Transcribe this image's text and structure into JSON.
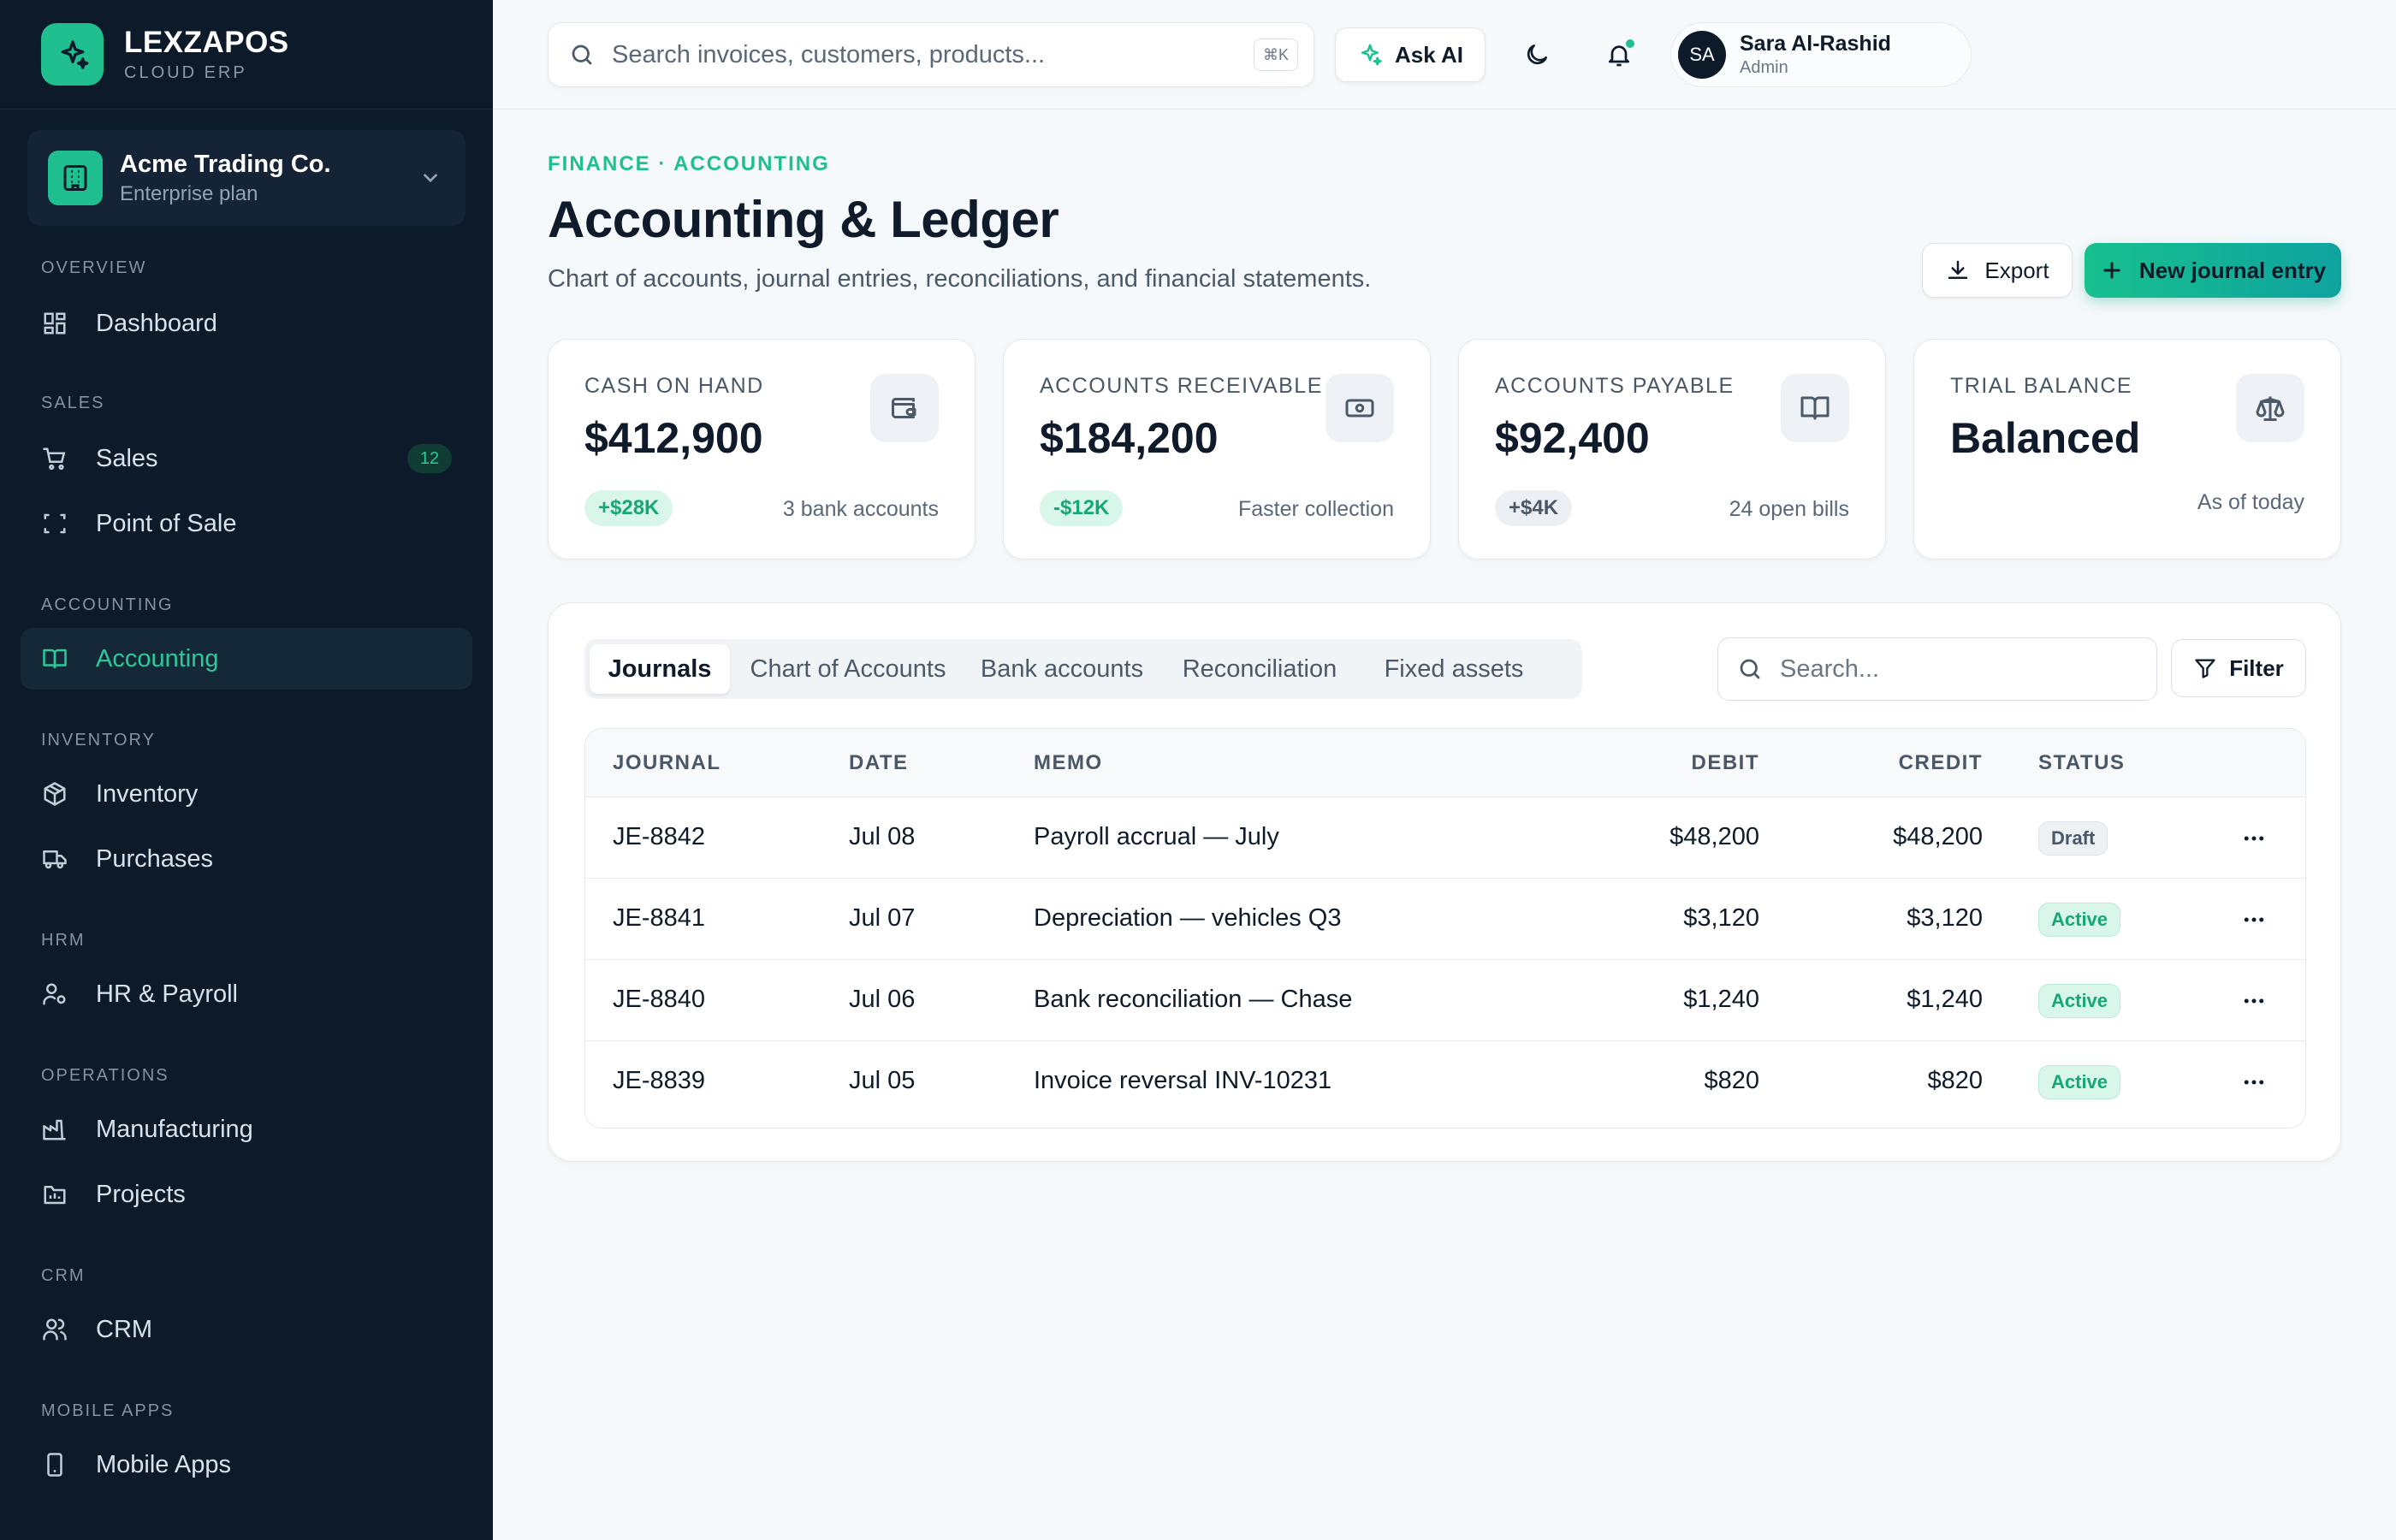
{
  "brand": {
    "name": "LEXZAPOS",
    "sub": "CLOUD ERP",
    "logo_icon": "sparkle-icon"
  },
  "org": {
    "name": "Acme Trading Co.",
    "plan": "Enterprise plan"
  },
  "sidebar": {
    "sections": [
      "OVERVIEW",
      "SALES",
      "ACCOUNTING",
      "INVENTORY",
      "HRM",
      "OPERATIONS",
      "CRM",
      "MOBILE APPS"
    ],
    "items": [
      {
        "label": "Dashboard",
        "icon": "grid-icon"
      },
      {
        "label": "Sales",
        "icon": "cart-icon",
        "badge": "12"
      },
      {
        "label": "Point of Sale",
        "icon": "scan-icon"
      },
      {
        "label": "Accounting",
        "icon": "book-icon",
        "active": true
      },
      {
        "label": "Inventory",
        "icon": "box-icon"
      },
      {
        "label": "Purchases",
        "icon": "truck-icon"
      },
      {
        "label": "HR & Payroll",
        "icon": "user-cog-icon"
      },
      {
        "label": "Manufacturing",
        "icon": "factory-icon"
      },
      {
        "label": "Projects",
        "icon": "folder-icon"
      },
      {
        "label": "CRM",
        "icon": "users-icon"
      },
      {
        "label": "Mobile Apps",
        "icon": "smartphone-icon"
      }
    ]
  },
  "topbar": {
    "search_placeholder": "Search invoices, customers, products...",
    "search_shortcut": "⌘K",
    "ask_ai_label": "Ask AI",
    "user": {
      "initials": "SA",
      "name": "Sara Al-Rashid",
      "role": "Admin"
    }
  },
  "page": {
    "breadcrumb": "FINANCE · ACCOUNTING",
    "title": "Accounting & Ledger",
    "subtitle": "Chart of accounts, journal entries, reconciliations, and financial statements.",
    "export_label": "Export",
    "new_entry_label": "New journal entry"
  },
  "kpis": [
    {
      "label": "CASH ON HAND",
      "value": "$412,900",
      "pill": "+$28K",
      "note": "3 bank accounts",
      "icon": "wallet-icon"
    },
    {
      "label": "ACCOUNTS RECEIVABLE",
      "value": "$184,200",
      "pill": "-$12K",
      "note": "Faster collection",
      "icon": "banknote-icon"
    },
    {
      "label": "ACCOUNTS PAYABLE",
      "value": "$92,400",
      "pill": "+$4K",
      "note": "24 open bills",
      "icon": "book-open-icon"
    },
    {
      "label": "TRIAL BALANCE",
      "value": "Balanced",
      "pill": "",
      "note": "As of today",
      "icon": "scale-icon"
    }
  ],
  "tabs": [
    "Journals",
    "Chart of Accounts",
    "Bank accounts",
    "Reconciliation",
    "Fixed assets"
  ],
  "panel": {
    "search_placeholder": "Search...",
    "filter_label": "Filter"
  },
  "table": {
    "columns": [
      "JOURNAL",
      "DATE",
      "MEMO",
      "DEBIT",
      "CREDIT",
      "STATUS"
    ],
    "rows": [
      {
        "journal": "JE-8842",
        "date": "Jul 08",
        "memo": "Payroll accrual — July",
        "debit": "$48,200",
        "credit": "$48,200",
        "status": "Draft"
      },
      {
        "journal": "JE-8841",
        "date": "Jul 07",
        "memo": "Depreciation — vehicles Q3",
        "debit": "$3,120",
        "credit": "$3,120",
        "status": "Active"
      },
      {
        "journal": "JE-8840",
        "date": "Jul 06",
        "memo": "Bank reconciliation — Chase",
        "debit": "$1,240",
        "credit": "$1,240",
        "status": "Active"
      },
      {
        "journal": "JE-8839",
        "date": "Jul 05",
        "memo": "Invoice reversal INV-10231",
        "debit": "$820",
        "credit": "$820",
        "status": "Active"
      }
    ]
  },
  "colors": {
    "sidebar_bg": "#0c1a2a",
    "accent": "#1fbf8f",
    "active_text": "#2cc99a"
  }
}
